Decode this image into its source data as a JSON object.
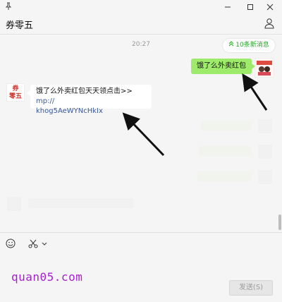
{
  "window": {
    "contact_name": "券零五"
  },
  "chat": {
    "timestamp": "20:27",
    "new_messages_pill": "10条新消息",
    "messages": [
      {
        "direction": "outgoing",
        "text": "饿了么外卖红包"
      },
      {
        "direction": "incoming",
        "text_line1": "饿了么外卖红包天天领点击>>",
        "link_part1": "mp://",
        "link_part2": "khog5AeWYNcHkIx"
      }
    ],
    "left_avatar_text_line1": "券",
    "left_avatar_text_line2": "零五"
  },
  "toolbar": {
    "emoji_icon": "emoji-icon",
    "screenshot_icon": "scissors-icon"
  },
  "composer": {
    "watermark": "quan05.com",
    "send_label": "发送(S)"
  },
  "colors": {
    "outgoing_bubble": "#9eea6a",
    "incoming_bubble": "#ffffff",
    "pill_text": "#1aad19",
    "link": "#3b5998",
    "watermark": "#a61fd3"
  }
}
